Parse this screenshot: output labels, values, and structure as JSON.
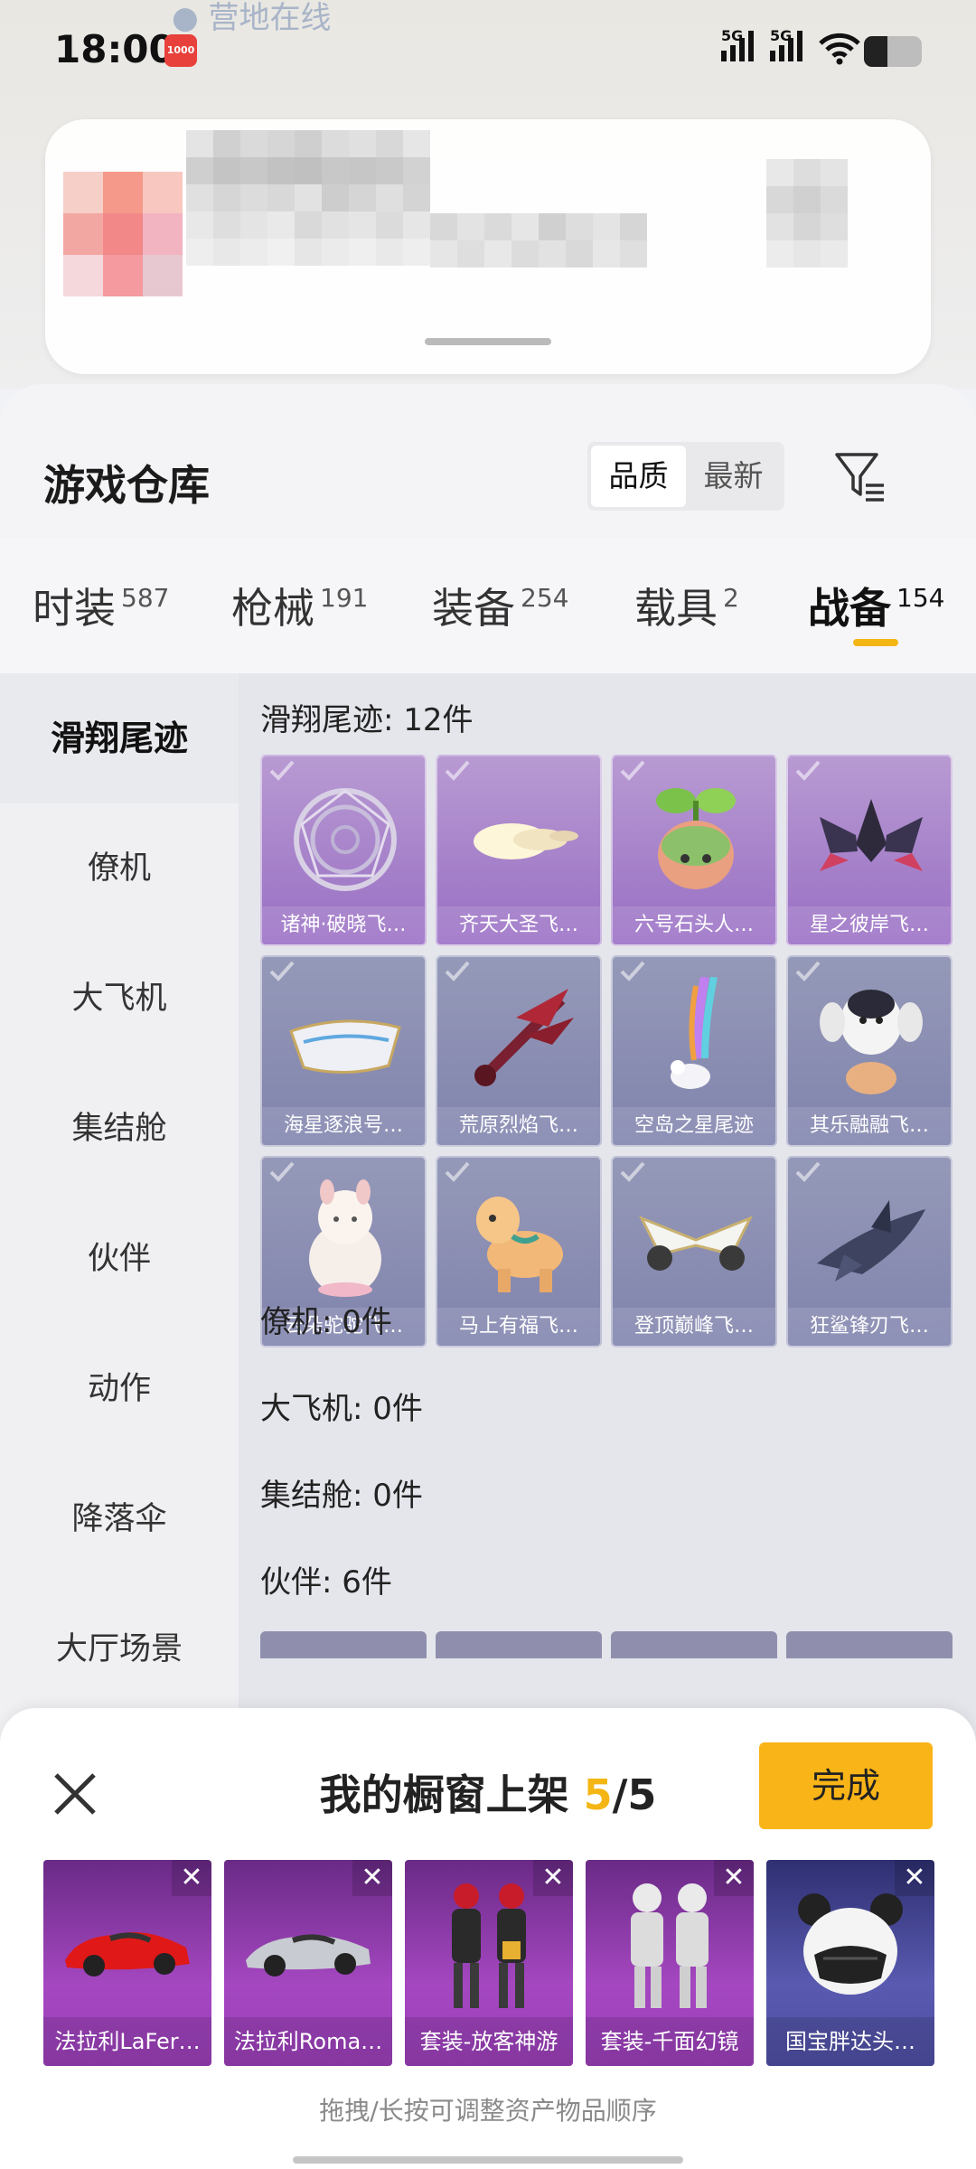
{
  "status_bar": {
    "time": "18:00",
    "app_badge": "",
    "online_label": "● 营地在线",
    "net1": "5G",
    "net2": "5G"
  },
  "header": {
    "title": "游戏仓库",
    "sort_options": [
      "品质",
      "最新"
    ],
    "sort_active": "品质",
    "filter_icon": "filter-icon"
  },
  "tabs": [
    {
      "label": "时装",
      "count": "587"
    },
    {
      "label": "枪械",
      "count": "191"
    },
    {
      "label": "装备",
      "count": "254"
    },
    {
      "label": "载具",
      "count": "2"
    },
    {
      "label": "战备",
      "count": "154",
      "active": true
    }
  ],
  "sidebar": {
    "items": [
      "滑翔尾迹",
      "僚机",
      "大飞机",
      "集结舱",
      "伙伴",
      "动作",
      "降落伞",
      "大厅场景"
    ],
    "active": "滑翔尾迹"
  },
  "sections": [
    {
      "title": "滑翔尾迹: 12件"
    },
    {
      "title": "僚机: 0件"
    },
    {
      "title": "大飞机: 0件"
    },
    {
      "title": "集结舱: 0件"
    },
    {
      "title": "伙伴: 6件"
    }
  ],
  "items": [
    {
      "name": "诸神·破晓飞…",
      "rarity": "purple"
    },
    {
      "name": "齐天大圣飞…",
      "rarity": "purple"
    },
    {
      "name": "六号石头人…",
      "rarity": "purple"
    },
    {
      "name": "星之彼岸飞…",
      "rarity": "purple"
    },
    {
      "name": "海星逐浪号…",
      "rarity": "blue"
    },
    {
      "name": "荒原烈焰飞…",
      "rarity": "blue"
    },
    {
      "name": "空岛之星尾迹",
      "rarity": "blue"
    },
    {
      "name": "其乐融融飞…",
      "rarity": "blue"
    },
    {
      "name": "云朵驼驼飞…",
      "rarity": "blue"
    },
    {
      "name": "马上有福飞…",
      "rarity": "blue"
    },
    {
      "name": "登顶巅峰飞…",
      "rarity": "blue"
    },
    {
      "name": "狂鲨锋刃飞…",
      "rarity": "blue"
    }
  ],
  "showcase": {
    "title_prefix": "我的橱窗上架",
    "count": "5",
    "total": "/5",
    "done_label": "完成",
    "slots": [
      {
        "name": "法拉利LaFer…",
        "rarity": "purple"
      },
      {
        "name": "法拉利Roma…",
        "rarity": "purple"
      },
      {
        "name": "套装-放客神游",
        "rarity": "purple"
      },
      {
        "name": "套装-千面幻镜",
        "rarity": "purple"
      },
      {
        "name": "国宝胖达头…",
        "rarity": "blue"
      }
    ],
    "hint": "拖拽/长按可调整资产物品顺序"
  },
  "colors": {
    "accent": "#f9b418",
    "purple_tile": "#a27cc8",
    "blue_tile": "#878ab0"
  }
}
